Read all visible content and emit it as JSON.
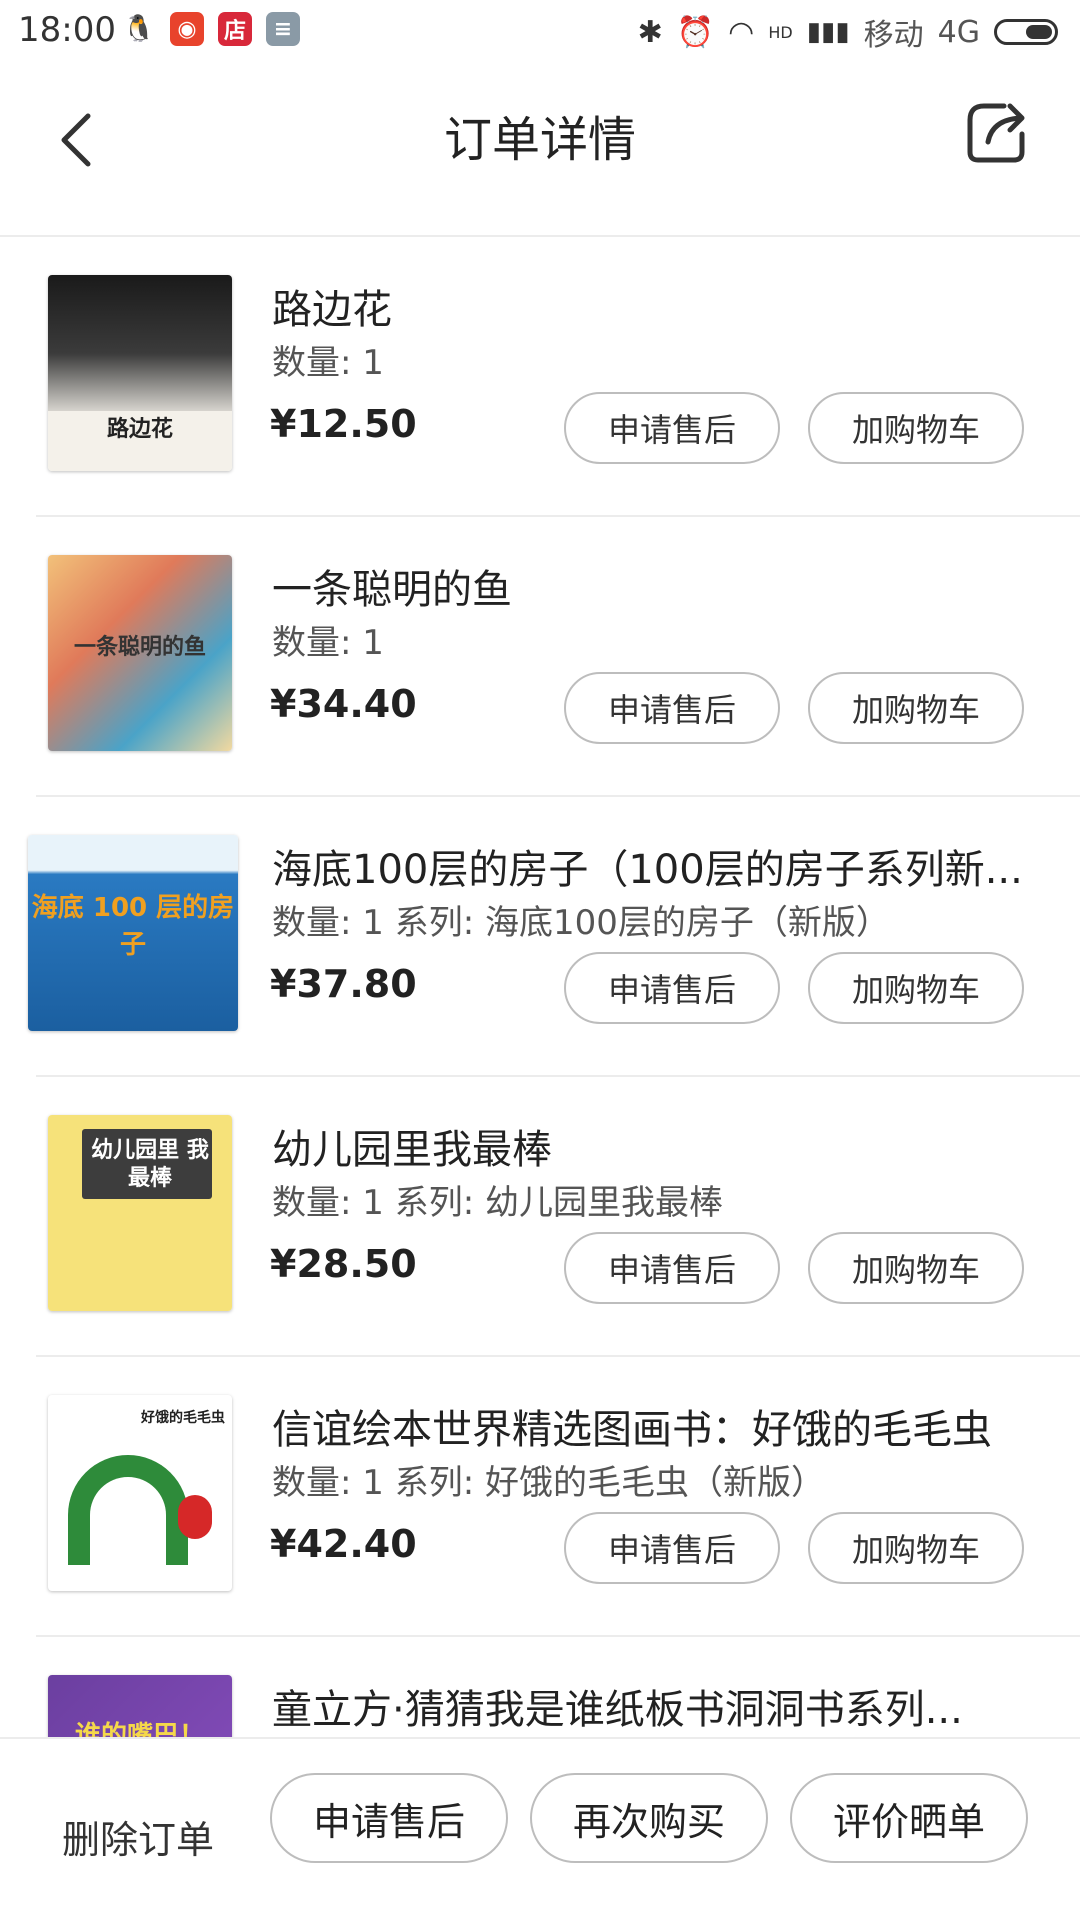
{
  "status_bar": {
    "time": "18:00",
    "app_badge_shop": "店",
    "carrier": "移动",
    "network": "4G",
    "hd": "HD"
  },
  "header": {
    "title": "订单详情"
  },
  "items": [
    {
      "title": "路边花",
      "meta": "数量: 1",
      "price": "¥12.50",
      "cover_label": "路边花",
      "cover_colors": [
        "#f4f1ea",
        "#222222"
      ],
      "btn_after_sale": "申请售后",
      "btn_add_cart": "加购物车"
    },
    {
      "title": "一条聪明的鱼",
      "meta": "数量: 1",
      "price": "¥34.40",
      "cover_label": "一条聪明的鱼",
      "cover_colors": [
        "#f2c17a",
        "#4aa3c8"
      ],
      "btn_after_sale": "申请售后",
      "btn_add_cart": "加购物车"
    },
    {
      "title": "海底100层的房子（100层的房子系列新...",
      "meta": "数量: 1 系列: 海底100层的房子（新版）",
      "price": "¥37.80",
      "cover_label": "海底 100 层的房子",
      "cover_colors": [
        "#1f6fb8",
        "#f0a020"
      ],
      "btn_after_sale": "申请售后",
      "btn_add_cart": "加购物车"
    },
    {
      "title": "幼儿园里我最棒",
      "meta": "数量: 1 系列: 幼儿园里我最棒",
      "price": "¥28.50",
      "cover_label": "幼儿园里 我最棒",
      "cover_colors": [
        "#f6e27a",
        "#3d3d3d"
      ],
      "btn_after_sale": "申请售后",
      "btn_add_cart": "加购物车"
    },
    {
      "title": "信谊绘本世界精选图画书：好饿的毛毛虫",
      "meta": "数量: 1 系列: 好饿的毛毛虫（新版）",
      "price": "¥42.40",
      "cover_label": "好饿的毛毛虫",
      "cover_colors": [
        "#ffffff",
        "#2e8b3a"
      ],
      "btn_after_sale": "申请售后",
      "btn_add_cart": "加购物车"
    },
    {
      "title": "童立方·猜猜我是谁纸板书洞洞书系列...",
      "meta": "",
      "price": "",
      "cover_label": "谁的嘴巴！",
      "cover_colors": [
        "#6b3fa0",
        "#f5d84a"
      ],
      "btn_after_sale": "",
      "btn_add_cart": ""
    }
  ],
  "bottom_bar": {
    "delete_order": "删除订单",
    "after_sale": "申请售后",
    "buy_again": "再次购买",
    "review": "评价晒单"
  }
}
